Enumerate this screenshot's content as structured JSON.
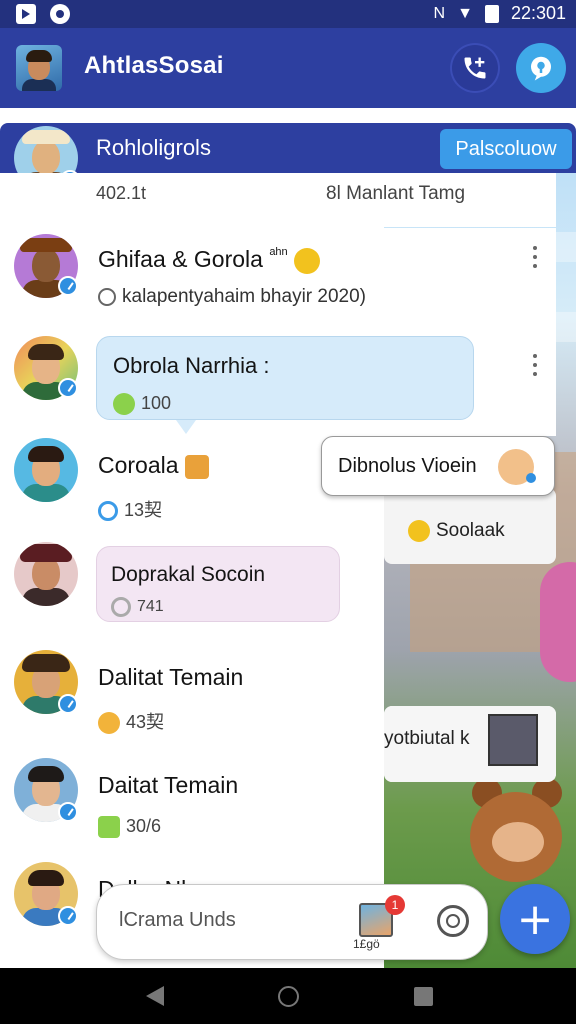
{
  "status_bar": {
    "time": "22:301",
    "network_label": "N"
  },
  "app_bar": {
    "title": "AhtlasSosai"
  },
  "subscription_header": {
    "title": "Rohloligrols",
    "action_label": "Palscoluow"
  },
  "list_header": {
    "left_count": "402.1t",
    "right_label": "8l Manlant Tamg"
  },
  "chats": [
    {
      "name": "Ghifaa & Gorola",
      "name_suffix": "ahn",
      "subtitle": "kalapentyahaim bhayir 2020)"
    },
    {
      "name": "Obrola Narrhia :",
      "meta": "100"
    },
    {
      "name": "Coroala",
      "meta": "13契"
    },
    {
      "name": "Doprakal Socoin",
      "meta": "741"
    },
    {
      "name": "Dalitat Temain",
      "meta": "43契"
    },
    {
      "name": "Daitat Temain",
      "meta": "30/6"
    },
    {
      "name": "Dalhe Nl"
    }
  ],
  "floating_cards": {
    "video_label": "Dibnolus Vioein",
    "side_label": "Soolaak",
    "side_label_2": "yotbiutal k"
  },
  "composer": {
    "placeholder": "lCrama Unds",
    "badge_count": "1",
    "attachment_label": "1£ɡö"
  },
  "colors": {
    "primary": "#2d3fa0",
    "accent": "#3b9be8",
    "fab": "#3a73e0",
    "bubble_blue": "#d6ebfa",
    "bubble_pink": "#f3e6f3"
  }
}
